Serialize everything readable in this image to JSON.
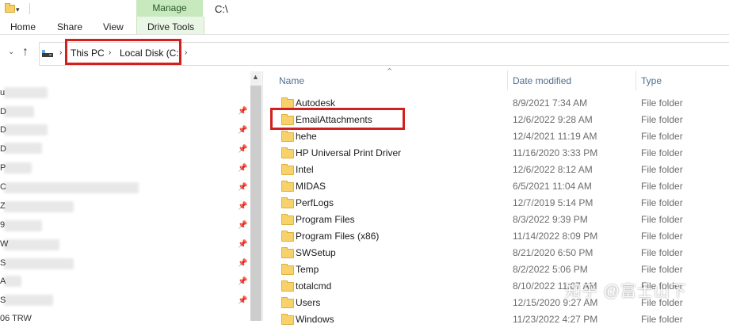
{
  "window": {
    "path_title": "C:\\"
  },
  "ribbon": {
    "contextual_tab": "Manage",
    "tabs": [
      "Home",
      "Share",
      "View",
      "Drive Tools"
    ]
  },
  "address_bar": {
    "crumbs": [
      "This PC",
      "Local Disk (C:)"
    ],
    "chevron": "›"
  },
  "nav_pane": {
    "visible_fragment": "06 TRW",
    "letters": [
      "u",
      "D",
      "D",
      "D",
      "P",
      "C",
      "Z",
      "9",
      "W",
      "S",
      "A",
      "S"
    ]
  },
  "columns": {
    "name": "Name",
    "date": "Date modified",
    "type": "Type"
  },
  "files": [
    {
      "name": "Autodesk",
      "date": "8/9/2021 7:34 AM",
      "type": "File folder"
    },
    {
      "name": "EmailAttachments",
      "date": "12/6/2022 9:28 AM",
      "type": "File folder"
    },
    {
      "name": "hehe",
      "date": "12/4/2021 11:19 AM",
      "type": "File folder"
    },
    {
      "name": "HP Universal Print Driver",
      "date": "11/16/2020 3:33 PM",
      "type": "File folder"
    },
    {
      "name": "Intel",
      "date": "12/6/2022 8:12 AM",
      "type": "File folder"
    },
    {
      "name": "MIDAS",
      "date": "6/5/2021 11:04 AM",
      "type": "File folder"
    },
    {
      "name": "PerfLogs",
      "date": "12/7/2019 5:14 PM",
      "type": "File folder"
    },
    {
      "name": "Program Files",
      "date": "8/3/2022 9:39 PM",
      "type": "File folder"
    },
    {
      "name": "Program Files (x86)",
      "date": "11/14/2022 8:09 PM",
      "type": "File folder"
    },
    {
      "name": "SWSetup",
      "date": "8/21/2020 6:50 PM",
      "type": "File folder"
    },
    {
      "name": "Temp",
      "date": "8/2/2022 5:06 PM",
      "type": "File folder"
    },
    {
      "name": "totalcmd",
      "date": "8/10/2022 11:07 AM",
      "type": "File folder"
    },
    {
      "name": "Users",
      "date": "12/15/2020 9:27 AM",
      "type": "File folder"
    },
    {
      "name": "Windows",
      "date": "11/23/2022 4:27 PM",
      "type": "File folder"
    }
  ],
  "watermark": "知乎 @富士山下",
  "colors": {
    "highlight": "#d2201f",
    "manage_tab": "#c8e8bd",
    "folder": "#f7d26a",
    "header_text": "#4d6f91"
  }
}
